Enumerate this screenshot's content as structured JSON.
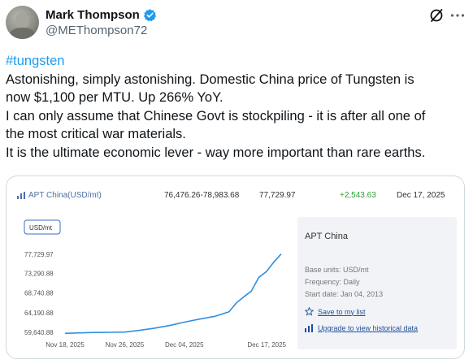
{
  "author": {
    "display_name": "Mark Thompson",
    "handle": "@METhompson72",
    "verified_color": "#1d9bf0"
  },
  "post": {
    "hashtag": "#tungsten",
    "lines": [
      "Astonishing, simply astonishing. Domestic China price of Tungsten is",
      "now $1,100 per MTU. Up 266% YoY.",
      "I can only assume that Chinese Govt is stockpiling - it is after all one of",
      "the most critical war materials.",
      "It is the ultimate economic lever - way more important than rare earths."
    ]
  },
  "card": {
    "header": {
      "title": "APT China(USD/mt)",
      "range": "76,476.26-78,983.68",
      "price": "77,729.97",
      "change": "+2,543.63",
      "date": "Dec 17, 2025",
      "change_color": "#2e9d3a"
    },
    "info": {
      "title": "APT China",
      "base_units": "Base units: USD/mt",
      "frequency": "Frequency: Daily",
      "start_date": "Start date: Jan 04, 2013",
      "save_link": "Save to my list",
      "upgrade_link": "Upgrade to view historical data"
    }
  },
  "chart_data": {
    "type": "line",
    "unit_label": "USD/mt",
    "y_ticks": [
      "77,729.97",
      "73,290.88",
      "68,740.88",
      "64,190.88",
      "59,640.88"
    ],
    "x_ticks": [
      "Nov 18, 2025",
      "Nov 26, 2025",
      "Dec 04, 2025",
      "Dec 17, 2025"
    ],
    "ylim": [
      59640.88,
      77729.97
    ],
    "series": [
      {
        "color": "#2f8fe0",
        "points": [
          {
            "x": "2025-11-18",
            "y": 59400
          },
          {
            "x": "2025-11-20",
            "y": 59500
          },
          {
            "x": "2025-11-22",
            "y": 59600
          },
          {
            "x": "2025-11-24",
            "y": 59650
          },
          {
            "x": "2025-11-26",
            "y": 59700
          },
          {
            "x": "2025-11-28",
            "y": 60100
          },
          {
            "x": "2025-11-30",
            "y": 60600
          },
          {
            "x": "2025-12-02",
            "y": 61200
          },
          {
            "x": "2025-12-04",
            "y": 62000
          },
          {
            "x": "2025-12-06",
            "y": 62700
          },
          {
            "x": "2025-12-08",
            "y": 63300
          },
          {
            "x": "2025-12-10",
            "y": 64400
          },
          {
            "x": "2025-12-11",
            "y": 66500
          },
          {
            "x": "2025-12-12",
            "y": 67900
          },
          {
            "x": "2025-12-13",
            "y": 69200
          },
          {
            "x": "2025-12-14",
            "y": 72400
          },
          {
            "x": "2025-12-15",
            "y": 73700
          },
          {
            "x": "2025-12-16",
            "y": 75900
          },
          {
            "x": "2025-12-17",
            "y": 77800
          }
        ]
      }
    ],
    "grid": false
  }
}
